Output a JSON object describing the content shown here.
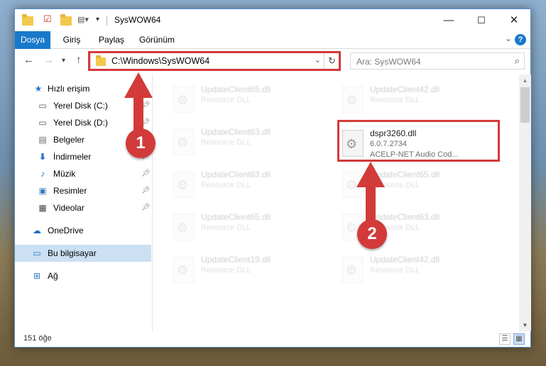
{
  "window": {
    "title": "SysWOW64",
    "controls": {
      "minimize": "—",
      "maximize": "☐",
      "close": "✕"
    }
  },
  "ribbon": {
    "tabs": [
      {
        "label": "Dosya",
        "active": true
      },
      {
        "label": "Giriş",
        "active": false
      },
      {
        "label": "Paylaş",
        "active": false
      },
      {
        "label": "Görünüm",
        "active": false
      }
    ],
    "help": "?"
  },
  "address": {
    "path": "C:\\Windows\\SysWOW64",
    "search_placeholder": "Ara: SysWOW64"
  },
  "sidebar": {
    "items": [
      {
        "label": "Hızlı erişim",
        "icon": "star-icon"
      },
      {
        "label": "Yerel Disk (C:)",
        "icon": "drive-icon",
        "pinned": true
      },
      {
        "label": "Yerel Disk (D:)",
        "icon": "drive-icon",
        "pinned": true
      },
      {
        "label": "Belgeler",
        "icon": "documents-icon",
        "pinned": true
      },
      {
        "label": "İndirmeler",
        "icon": "downloads-icon",
        "pinned": true
      },
      {
        "label": "Müzik",
        "icon": "music-icon",
        "pinned": true
      },
      {
        "label": "Resimler",
        "icon": "pictures-icon",
        "pinned": true
      },
      {
        "label": "Videolar",
        "icon": "videos-icon",
        "pinned": true
      },
      {
        "label": "OneDrive",
        "icon": "cloud-icon"
      },
      {
        "label": "Bu bilgisayar",
        "icon": "computer-icon",
        "selected": true
      },
      {
        "label": "Ağ",
        "icon": "network-icon"
      }
    ]
  },
  "files": [
    {
      "name": "UpdateClient65.dll",
      "line2": "Resource DLL",
      "line3": ""
    },
    {
      "name": "UpdateClient42.dll",
      "line2": "Resource DLL",
      "line3": ""
    },
    {
      "name": "UpdateClient63.dll",
      "line2": "Resource DLL",
      "line3": ""
    },
    {
      "name": "dspr3260.dll",
      "line2": "6.0.7.2734",
      "line3": "ACELP-NET Audio Cod...",
      "highlighted": true
    },
    {
      "name": "UpdateClient63.dll",
      "line2": "Resource DLL",
      "line3": ""
    },
    {
      "name": "UpdateClient65.dll",
      "line2": "Resource DLL",
      "line3": ""
    },
    {
      "name": "UpdateClient65.dll",
      "line2": "Resource DLL",
      "line3": ""
    },
    {
      "name": "UpdateClient63.dll",
      "line2": "Resource DLL",
      "line3": ""
    },
    {
      "name": "UpdateClient19.dll",
      "line2": "Resource DLL",
      "line3": ""
    },
    {
      "name": "UpdateClient42.dll",
      "line2": "Resource DLL",
      "line3": ""
    }
  ],
  "status": {
    "count": "151 öğe"
  },
  "annotations": {
    "step1": "1",
    "step2": "2",
    "color": "#d33a3a"
  }
}
